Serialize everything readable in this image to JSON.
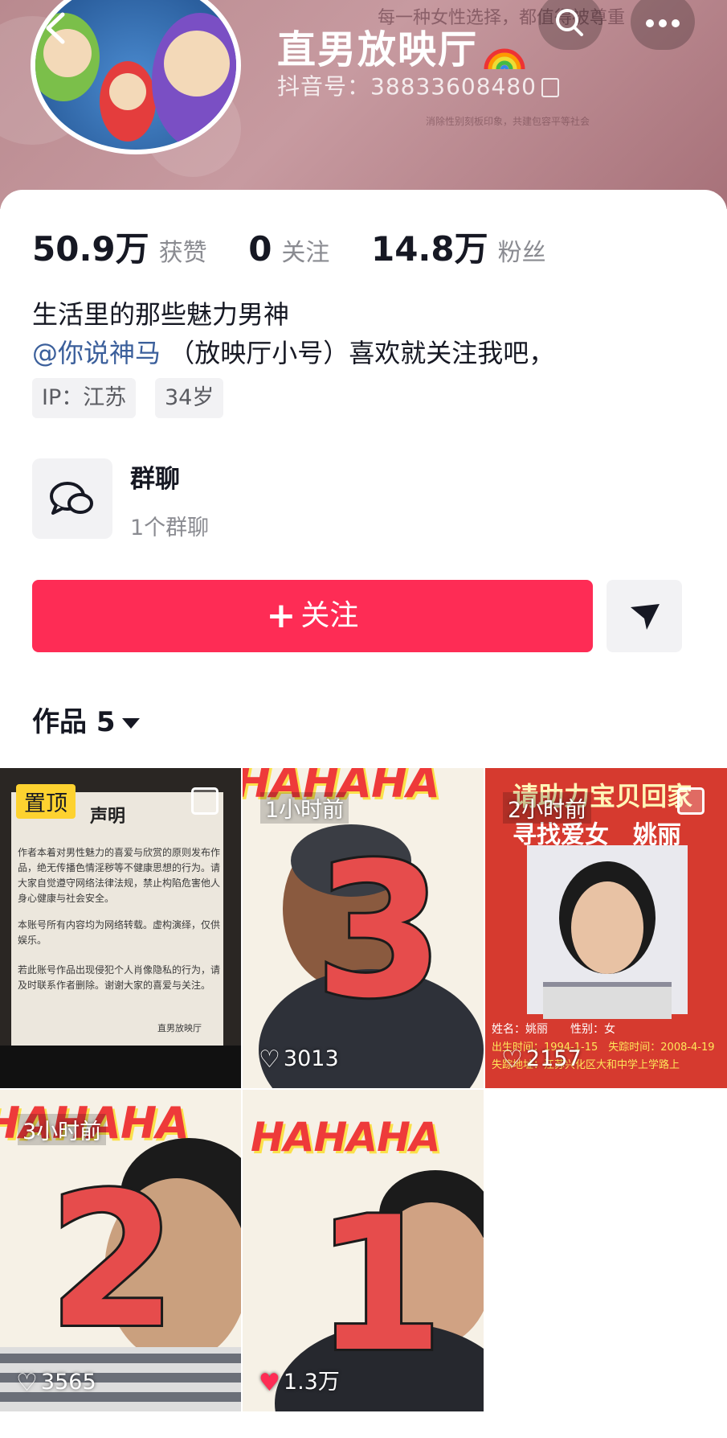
{
  "header": {
    "name": "直男放映厅",
    "douyin_id": "抖音号：38833608480",
    "bg_text_1": "每一种女性选择，都值得被尊重",
    "bg_text_2": "消除性别刻板印象，共建包容平等社会"
  },
  "stats": [
    {
      "value": "50.9万",
      "label": "获赞"
    },
    {
      "value": "0",
      "label": "关注"
    },
    {
      "value": "14.8万",
      "label": "粉丝"
    }
  ],
  "bio": {
    "line1": "生活里的那些魅力男神",
    "mention": "@你说神马",
    "line2_rest": " （放映厅小号）喜欢就关注我吧，"
  },
  "tags": [
    "IP：江苏",
    "34岁"
  ],
  "group": {
    "title": "群聊",
    "subtitle": "1个群聊"
  },
  "follow_label": "关注",
  "works_tab": "作品 5",
  "videos": [
    {
      "pinned_label": "置顶",
      "doc_title": "声明",
      "doc_p1": "作者本着对男性魅力的喜爱与欣赏的原则发布作品，绝无传播色情淫秽等不健康思想的行为。请大家自觉遵守网络法律法规，禁止构陷危害他人身心健康与社会安全。",
      "doc_p2": "本账号所有内容均为网络转载。虚构演绎，仅供娱乐。",
      "doc_p3": "若此账号作品出现侵犯个人肖像隐私的行为，请及时联系作者删除。谢谢大家的喜爱与关注。",
      "doc_sign": "直男放映厅"
    },
    {
      "time": "1小时前",
      "likes": "3013",
      "number": "3",
      "banner": "HAHAHA"
    },
    {
      "time": "2小时前",
      "likes": "2157",
      "banner": "请助力宝贝回家",
      "headline": "寻找爱女　姚丽",
      "info1": "姓名：姚丽　　性别：女",
      "info2": "出生时间：1994-1-15　失踪时间：2008-4-19",
      "info3": "失踪地址：江苏兴化区大和中学上学路上"
    },
    {
      "time": "3小时前",
      "likes": "3565",
      "number": "2",
      "banner": "HAHAHA"
    },
    {
      "likes": "1.3万",
      "number": "1",
      "banner": "HAHAHA"
    }
  ]
}
